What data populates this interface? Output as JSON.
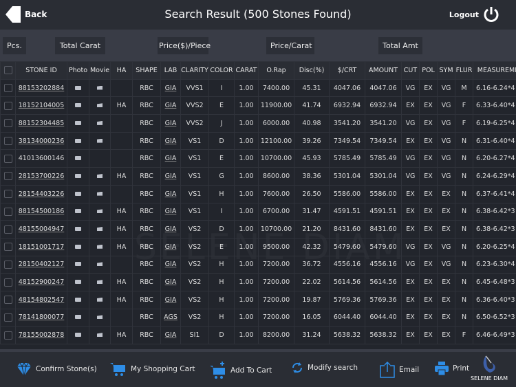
{
  "header": {
    "back_label": "Back",
    "title": "Search Result (500 Stones Found)",
    "logout_label": "Logout"
  },
  "summary": {
    "pcs": "Pcs.",
    "total_carat": "Total Carat",
    "price_piece": "Price($)/Piece",
    "price_carat": "Price/Carat",
    "total_amt": "Total Amt"
  },
  "columns": [
    "STONE ID",
    "Photo",
    "Movie",
    "HA",
    "SHAPE",
    "LAB",
    "CLARITY",
    "COLOR",
    "CARAT",
    "O.Rap",
    "Disc(%)",
    "$/CRT",
    "AMOUNT",
    "CUT",
    "POL",
    "SYM",
    "FLUR",
    "MEASUREME"
  ],
  "rows": [
    {
      "id": "88153202884",
      "photo": true,
      "movie": true,
      "ha": "",
      "shape": "RBC",
      "lab": "GIA",
      "clarity": "VVS1",
      "color": "I",
      "carat": "1.00",
      "orap": "7400.00",
      "disc": "45.31",
      "crt": "4047.06",
      "amount": "4047.06",
      "cut": "VG",
      "pol": "EX",
      "sym": "VG",
      "flur": "M",
      "meas": "6.16-6.24*4"
    },
    {
      "id": "18152104005",
      "photo": true,
      "movie": true,
      "ha": "HA",
      "shape": "RBC",
      "lab": "GIA",
      "clarity": "VVS2",
      "color": "E",
      "carat": "1.00",
      "orap": "11900.00",
      "disc": "41.74",
      "crt": "6932.94",
      "amount": "6932.94",
      "cut": "EX",
      "pol": "EX",
      "sym": "VG",
      "flur": "F",
      "meas": "6.33-6.40*4"
    },
    {
      "id": "88152304485",
      "photo": true,
      "movie": true,
      "ha": "",
      "shape": "RBC",
      "lab": "GIA",
      "clarity": "VVS2",
      "color": "J",
      "carat": "1.00",
      "orap": "6000.00",
      "disc": "40.98",
      "crt": "3541.20",
      "amount": "3541.20",
      "cut": "VG",
      "pol": "EX",
      "sym": "VG",
      "flur": "F",
      "meas": "6.19-6.25*4"
    },
    {
      "id": "38134000236",
      "photo": true,
      "movie": true,
      "ha": "",
      "shape": "RBC",
      "lab": "GIA",
      "clarity": "VS1",
      "color": "D",
      "carat": "1.00",
      "orap": "12100.00",
      "disc": "39.26",
      "crt": "7349.54",
      "amount": "7349.54",
      "cut": "EX",
      "pol": "EX",
      "sym": "VG",
      "flur": "N",
      "meas": "6.31-6.40*4"
    },
    {
      "id": "41013600146",
      "photo": true,
      "movie": false,
      "ha": "",
      "shape": "RBC",
      "lab": "GIA",
      "clarity": "VS1",
      "color": "E",
      "carat": "1.00",
      "orap": "10700.00",
      "disc": "45.93",
      "crt": "5785.49",
      "amount": "5785.49",
      "cut": "VG",
      "pol": "EX",
      "sym": "VG",
      "flur": "N",
      "meas": "6.20-6.27*4"
    },
    {
      "id": "28153700226",
      "photo": true,
      "movie": true,
      "ha": "HA",
      "shape": "RBC",
      "lab": "GIA",
      "clarity": "VS1",
      "color": "G",
      "carat": "1.00",
      "orap": "8600.00",
      "disc": "38.36",
      "crt": "5301.04",
      "amount": "5301.04",
      "cut": "VG",
      "pol": "EX",
      "sym": "VG",
      "flur": "N",
      "meas": "6.24-6.29*4"
    },
    {
      "id": "28154403226",
      "photo": true,
      "movie": true,
      "ha": "",
      "shape": "RBC",
      "lab": "GIA",
      "clarity": "VS1",
      "color": "H",
      "carat": "1.00",
      "orap": "7600.00",
      "disc": "26.50",
      "crt": "5586.00",
      "amount": "5586.00",
      "cut": "EX",
      "pol": "EX",
      "sym": "EX",
      "flur": "N",
      "meas": "6.37-6.41*4"
    },
    {
      "id": "88154500186",
      "photo": true,
      "movie": true,
      "ha": "HA",
      "shape": "RBC",
      "lab": "GIA",
      "clarity": "VS1",
      "color": "I",
      "carat": "1.00",
      "orap": "6700.00",
      "disc": "31.47",
      "crt": "4591.51",
      "amount": "4591.51",
      "cut": "EX",
      "pol": "EX",
      "sym": "EX",
      "flur": "N",
      "meas": "6.38-6.42*3"
    },
    {
      "id": "48155004947",
      "photo": true,
      "movie": true,
      "ha": "HA",
      "shape": "RBC",
      "lab": "GIA",
      "clarity": "VS2",
      "color": "D",
      "carat": "1.00",
      "orap": "10700.00",
      "disc": "21.20",
      "crt": "8431.60",
      "amount": "8431.60",
      "cut": "EX",
      "pol": "EX",
      "sym": "EX",
      "flur": "N",
      "meas": "6.38-6.42*3"
    },
    {
      "id": "18151001717",
      "photo": true,
      "movie": true,
      "ha": "HA",
      "shape": "RBC",
      "lab": "GIA",
      "clarity": "VS2",
      "color": "E",
      "carat": "1.00",
      "orap": "9500.00",
      "disc": "42.32",
      "crt": "5479.60",
      "amount": "5479.60",
      "cut": "VG",
      "pol": "EX",
      "sym": "VG",
      "flur": "N",
      "meas": "6.20-6.25*4"
    },
    {
      "id": "28150402127",
      "photo": true,
      "movie": true,
      "ha": "",
      "shape": "RBC",
      "lab": "GIA",
      "clarity": "VS2",
      "color": "H",
      "carat": "1.00",
      "orap": "7200.00",
      "disc": "36.72",
      "crt": "4556.16",
      "amount": "4556.16",
      "cut": "VG",
      "pol": "EX",
      "sym": "VG",
      "flur": "N",
      "meas": "6.23-6.30*4"
    },
    {
      "id": "48152900247",
      "photo": true,
      "movie": true,
      "ha": "HA",
      "shape": "RBC",
      "lab": "GIA",
      "clarity": "VS2",
      "color": "H",
      "carat": "1.00",
      "orap": "7200.00",
      "disc": "22.02",
      "crt": "5614.56",
      "amount": "5614.56",
      "cut": "EX",
      "pol": "EX",
      "sym": "EX",
      "flur": "N",
      "meas": "6.45-6.48*3"
    },
    {
      "id": "48154802547",
      "photo": true,
      "movie": true,
      "ha": "HA",
      "shape": "RBC",
      "lab": "GIA",
      "clarity": "VS2",
      "color": "H",
      "carat": "1.00",
      "orap": "7200.00",
      "disc": "19.87",
      "crt": "5769.36",
      "amount": "5769.36",
      "cut": "EX",
      "pol": "EX",
      "sym": "EX",
      "flur": "N",
      "meas": "6.36-6.40*3"
    },
    {
      "id": "78141800077",
      "photo": true,
      "movie": true,
      "ha": "",
      "shape": "RBC",
      "lab": "AGS",
      "clarity": "VS2",
      "color": "H",
      "carat": "1.00",
      "orap": "7200.00",
      "disc": "16.05",
      "crt": "6044.40",
      "amount": "6044.40",
      "cut": "EX",
      "pol": "EX",
      "sym": "EX",
      "flur": "N",
      "meas": "6.50-6.52*3"
    },
    {
      "id": "78155002878",
      "photo": true,
      "movie": true,
      "ha": "HA",
      "shape": "RBC",
      "lab": "GIA",
      "clarity": "SI1",
      "color": "D",
      "carat": "1.00",
      "orap": "8200.00",
      "disc": "31.24",
      "crt": "5638.32",
      "amount": "5638.32",
      "cut": "EX",
      "pol": "EX",
      "sym": "EX",
      "flur": "F",
      "meas": "6.46-6.49*3"
    }
  ],
  "footer": {
    "confirm": "Confirm Stone(s)",
    "cart": "My Shopping Cart",
    "add": "Add To Cart",
    "modify": "Modify search",
    "email": "Email",
    "print": "Print"
  },
  "logo": {
    "text": "SELENE DIAM",
    "watermark": "SELENE DIAM"
  },
  "colors": {
    "accent": "#2e8de6",
    "background": "#22252c",
    "topbar": "#2a2d34",
    "summary_bar": "#393c46"
  }
}
